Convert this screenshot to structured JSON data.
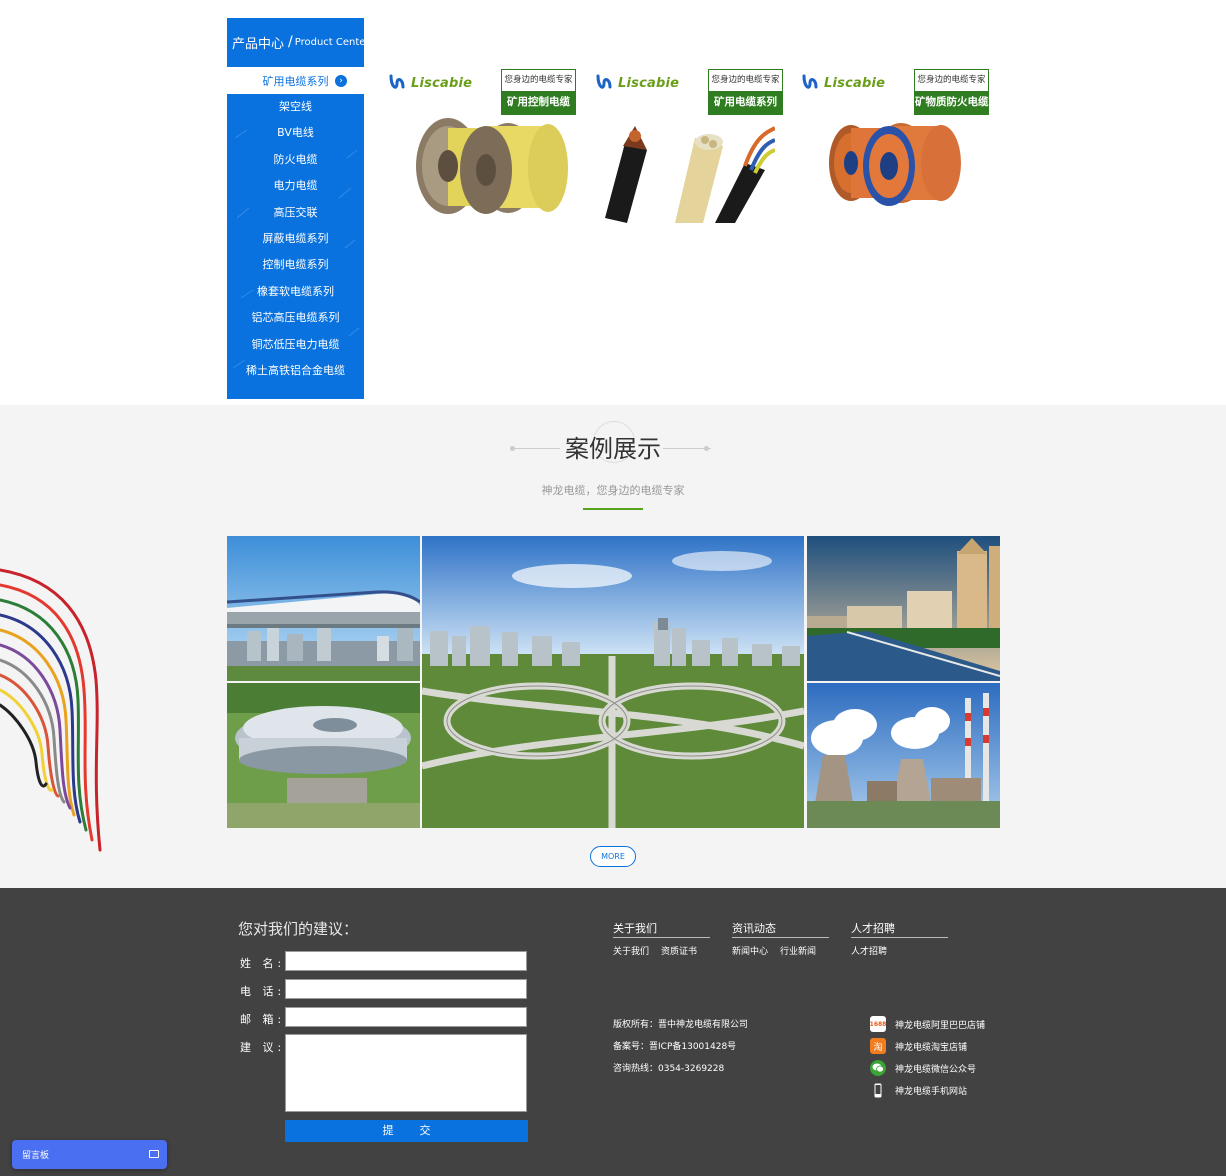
{
  "product_center": {
    "title_cn": "产品中心",
    "title_sep": "/",
    "title_en": "Product Center",
    "active_item": "矿用电缆系列",
    "items": [
      "架空线",
      "BV电线",
      "防火电缆",
      "电力电缆",
      "高压交联",
      "屏蔽电缆系列",
      "控制电缆系列",
      "橡套软电缆系列",
      "铝芯高压电缆系列",
      "铜芯低压电力电缆",
      "稀土高铁铝合金电缆"
    ]
  },
  "products": [
    {
      "brand": "Liscabie",
      "slogan": "您身边的电缆专家",
      "name": "矿用控制电缆",
      "pic": "yellow-cable-reels"
    },
    {
      "brand": "Liscabie",
      "slogan": "您身边的电缆专家",
      "name": "矿用电缆系列",
      "pic": "cable-cross-sections"
    },
    {
      "brand": "Liscabie",
      "slogan": "您身边的电缆专家",
      "name": "矿物质防火电缆",
      "pic": "orange-cable-reels"
    }
  ],
  "cases": {
    "title": "案例展示",
    "subtitle": "神龙电缆，您身边的电缆专家",
    "more_label": "MORE",
    "images": [
      "high-speed-train",
      "stadium",
      "highway-interchange",
      "city-buildings",
      "power-plant"
    ]
  },
  "feedback": {
    "title": "您对我们的建议：",
    "name_label": "姓 名:",
    "phone_label": "电 话:",
    "email_label": "邮 箱:",
    "suggest_label": "建 议:",
    "submit_label": "提交"
  },
  "footer_columns": [
    {
      "title": "关于我们",
      "links": [
        "关于我们",
        "资质证书"
      ]
    },
    {
      "title": "资讯动态",
      "links": [
        "新闻中心",
        "行业新闻"
      ]
    },
    {
      "title": "人才招聘",
      "links": [
        "人才招聘"
      ]
    }
  ],
  "company_info": {
    "copyright": "版权所有：晋中神龙电缆有限公司",
    "icp": "备案号：晋ICP备13001428号",
    "hotline": "咨询热线：0354-3269228"
  },
  "shops": [
    {
      "icon": "1688-icon",
      "icon_text": "1688",
      "color": "#e65c1b",
      "label": "神龙电缆阿里巴巴店铺"
    },
    {
      "icon": "taobao-icon",
      "icon_text": "淘",
      "color": "#f07d1f",
      "label": "神龙电缆淘宝店铺"
    },
    {
      "icon": "wechat-icon",
      "icon_text": "",
      "color": "#3aa435",
      "label": "神龙电缆微信公众号"
    },
    {
      "icon": "mobile-icon",
      "icon_text": "",
      "color": "#424242",
      "label": "神龙电缆手机网站"
    }
  ],
  "message_board": {
    "label": "留言板"
  },
  "colors": {
    "primary_blue": "#0a72de",
    "green": "#2f7d20",
    "accent_green": "#56a41c",
    "footer_bg": "#424242",
    "case_bg": "#f4f4f4"
  }
}
